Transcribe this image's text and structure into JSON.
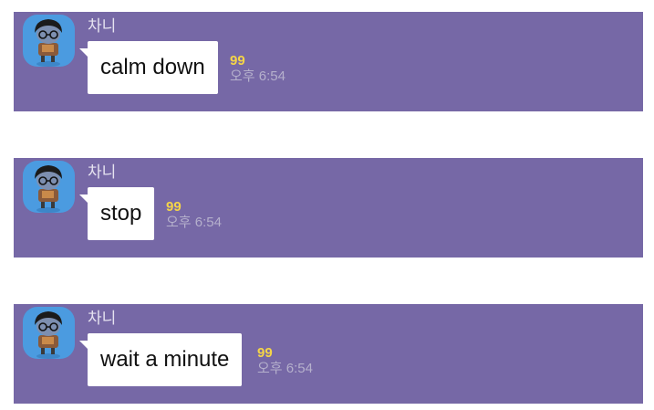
{
  "colors": {
    "panel_bg": "#7668a6",
    "bubble_bg": "#ffffff",
    "unread_count": "#f5d547",
    "timestamp": "#b5b0cc",
    "avatar_bg": "#4b9be0"
  },
  "messages": [
    {
      "sender": "차니",
      "text": "calm down",
      "unread": "99",
      "time": "오후 6:54",
      "avatar_icon": "character-avatar-icon"
    },
    {
      "sender": "차니",
      "text": "stop",
      "unread": "99",
      "time": "오후 6:54",
      "avatar_icon": "character-avatar-icon"
    },
    {
      "sender": "차니",
      "text": "wait a minute",
      "unread": "99",
      "time": "오후 6:54",
      "avatar_icon": "character-avatar-icon"
    }
  ]
}
